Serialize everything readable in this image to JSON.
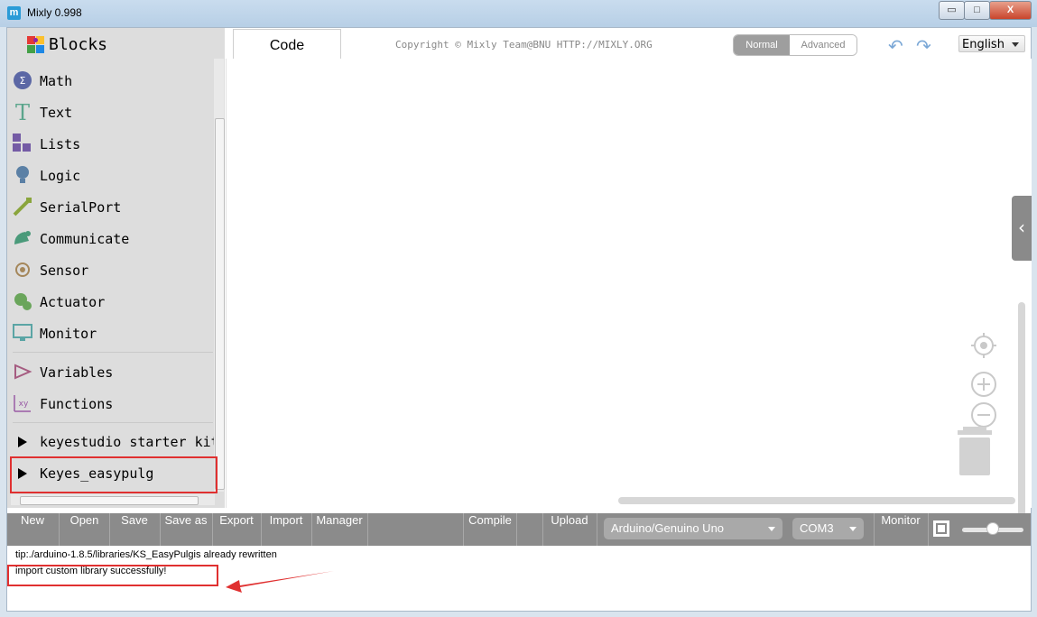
{
  "window": {
    "title": "Mixly 0.998",
    "app_icon": "m",
    "minimize": "▭",
    "maximize": "□",
    "close": "X"
  },
  "sidebar": {
    "title": "Blocks",
    "categories": [
      {
        "label": "Math",
        "icon": "math-icon"
      },
      {
        "label": "Text",
        "icon": "text-icon"
      },
      {
        "label": "Lists",
        "icon": "lists-icon"
      },
      {
        "label": "Logic",
        "icon": "logic-icon"
      },
      {
        "label": "SerialPort",
        "icon": "serialport-icon"
      },
      {
        "label": "Communicate",
        "icon": "communicate-icon"
      },
      {
        "label": "Sensor",
        "icon": "sensor-icon"
      },
      {
        "label": "Actuator",
        "icon": "actuator-icon"
      },
      {
        "label": "Monitor",
        "icon": "monitor-icon"
      },
      {
        "label": "Variables",
        "icon": "variables-icon"
      },
      {
        "label": "Functions",
        "icon": "functions-icon"
      }
    ],
    "extensions": [
      {
        "label": "keyestudio starter kit"
      },
      {
        "label": "Keyes_easypulg"
      }
    ]
  },
  "header": {
    "code_tab": "Code",
    "copyright": "Copyright © Mixly Team@BNU HTTP://MIXLY.ORG",
    "mode_normal": "Normal",
    "mode_advanced": "Advanced",
    "undo": "↶",
    "redo": "↷",
    "language": "English"
  },
  "workspace": {
    "toggle": "‹"
  },
  "toolbar": {
    "new": "New",
    "open": "Open",
    "save": "Save",
    "save_as": "Save as",
    "export": "Export",
    "import": "Import",
    "manager": "Manager",
    "compile": "Compile",
    "upload": "Upload",
    "board": "Arduino/Genuino Uno",
    "port": "COM3",
    "monitor": "Monitor",
    "zoom_fraction": 0.5
  },
  "console": {
    "line1": "tip:./arduino-1.8.5/libraries/KS_EasyPulgis already rewritten",
    "line2": "import custom library successfully!"
  },
  "colors": {
    "highlight": "#e03030",
    "toolbar": "#8b8b8b"
  }
}
